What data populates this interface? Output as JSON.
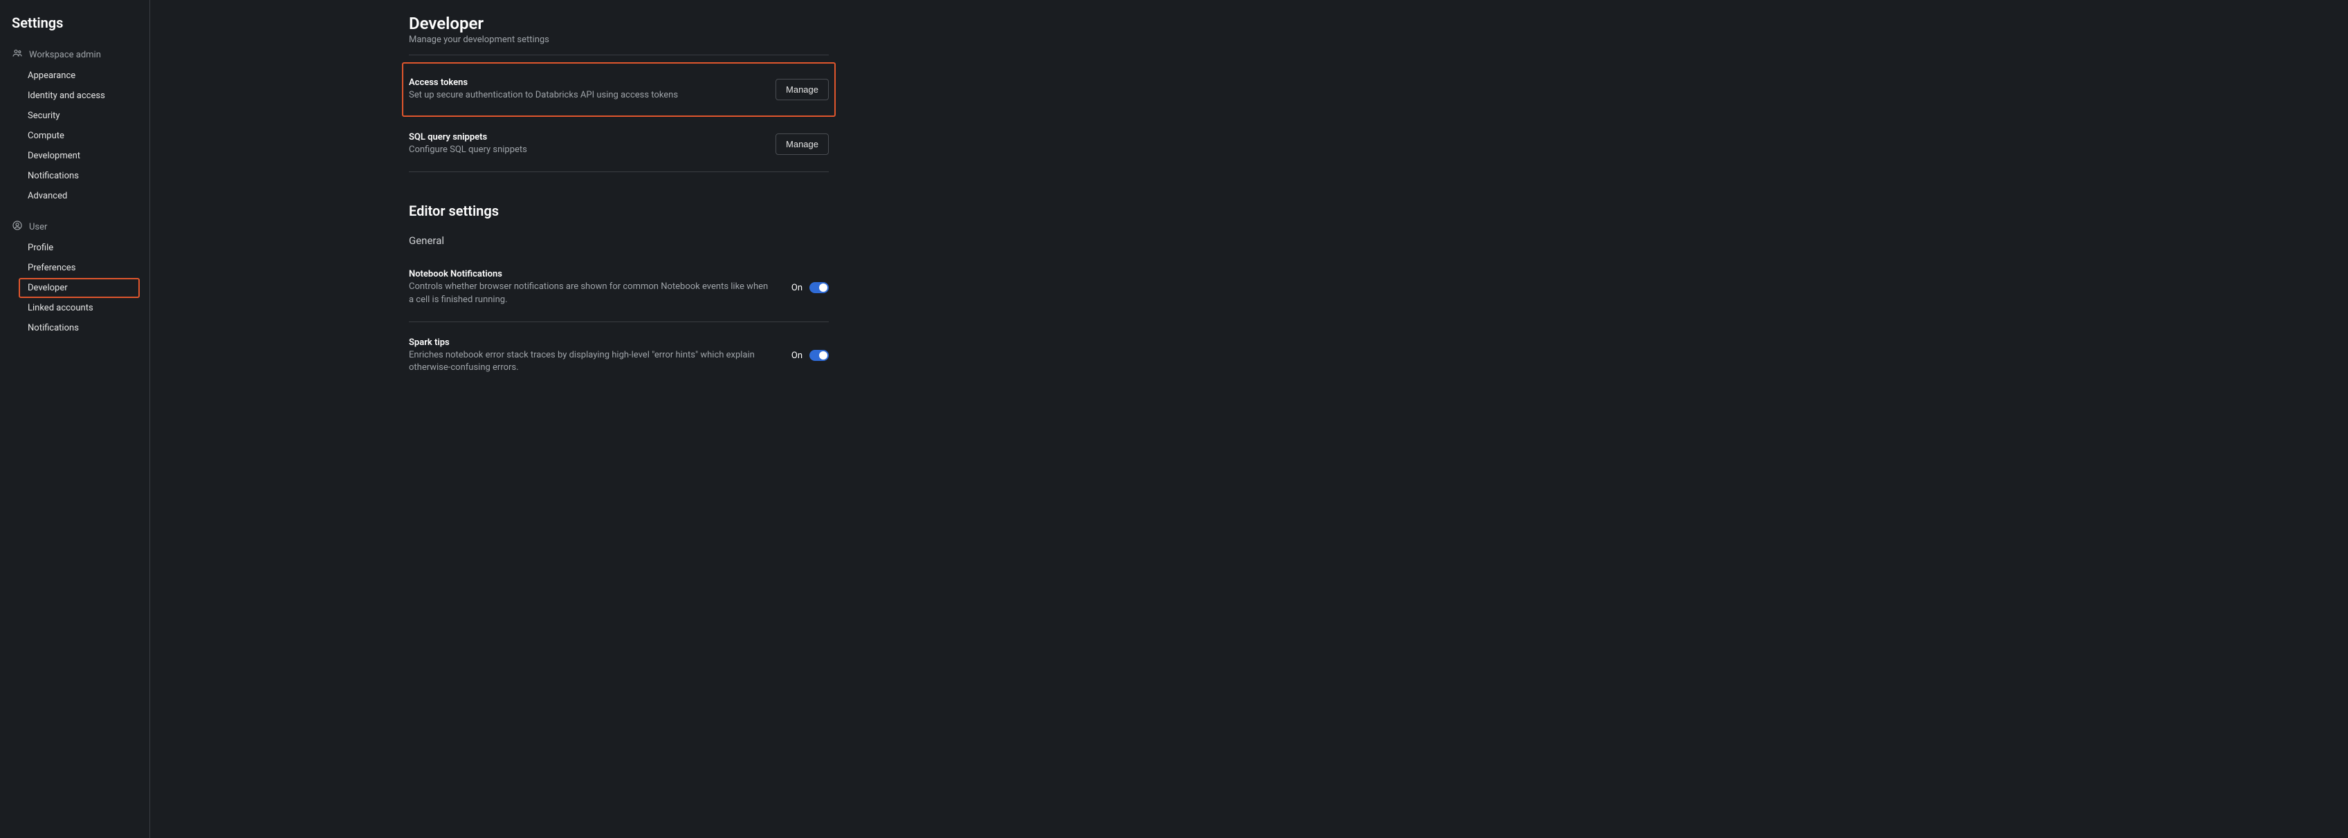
{
  "sidebar": {
    "title": "Settings",
    "sections": [
      {
        "header": "Workspace admin",
        "items": [
          "Appearance",
          "Identity and access",
          "Security",
          "Compute",
          "Development",
          "Notifications",
          "Advanced"
        ]
      },
      {
        "header": "User",
        "items": [
          "Profile",
          "Preferences",
          "Developer",
          "Linked accounts",
          "Notifications"
        ]
      }
    ],
    "active": "Developer"
  },
  "page": {
    "title": "Developer",
    "subtitle": "Manage your development settings"
  },
  "cards": {
    "access_tokens": {
      "title": "Access tokens",
      "desc": "Set up secure authentication to Databricks API using access tokens",
      "button": "Manage"
    },
    "sql_snippets": {
      "title": "SQL query snippets",
      "desc": "Configure SQL query snippets",
      "button": "Manage"
    }
  },
  "editor": {
    "heading": "Editor settings",
    "sub": "General",
    "notebook_notifications": {
      "title": "Notebook Notifications",
      "desc": "Controls whether browser notifications are shown for common Notebook events like when a cell is finished running.",
      "state": "On"
    },
    "spark_tips": {
      "title": "Spark tips",
      "desc": "Enriches notebook error stack traces by displaying high-level \"error hints\" which explain otherwise-confusing errors.",
      "state": "On"
    }
  }
}
